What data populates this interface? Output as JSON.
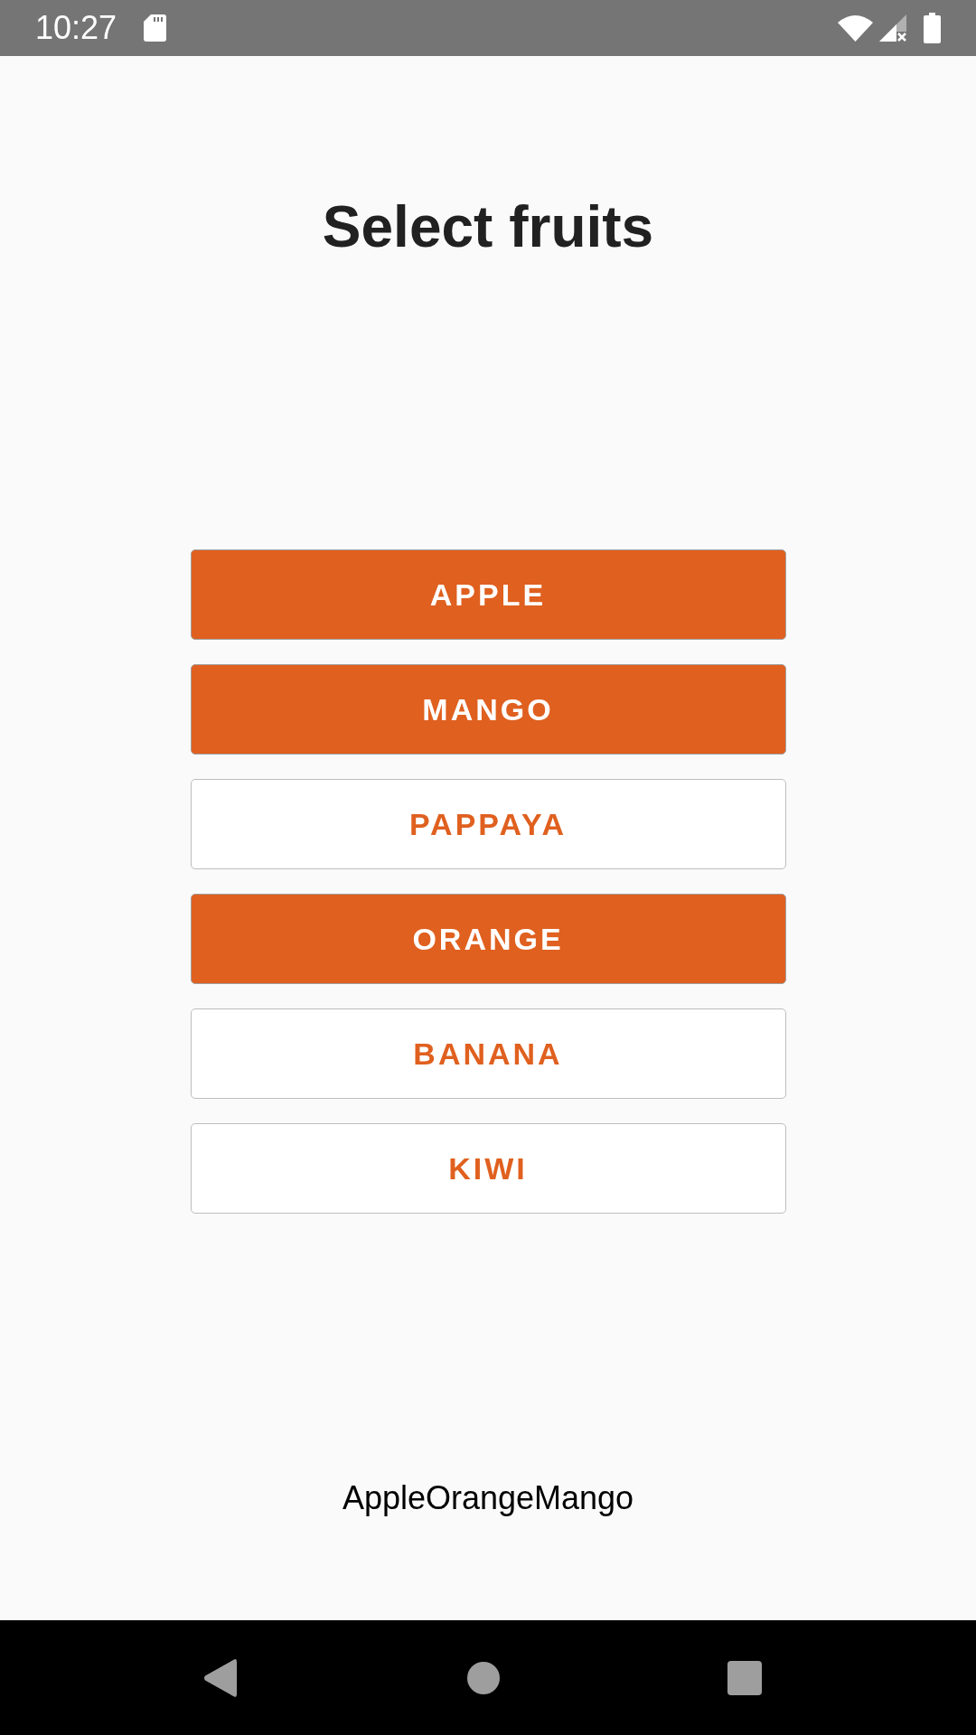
{
  "status_bar": {
    "time": "10:27"
  },
  "title": "Select fruits",
  "fruits": [
    {
      "label": "APPLE",
      "selected": true
    },
    {
      "label": "MANGO",
      "selected": true
    },
    {
      "label": "PAPPAYA",
      "selected": false
    },
    {
      "label": "ORANGE",
      "selected": true
    },
    {
      "label": "BANANA",
      "selected": false
    },
    {
      "label": "KIWI",
      "selected": false
    }
  ],
  "selection_text": "AppleOrangeMango"
}
